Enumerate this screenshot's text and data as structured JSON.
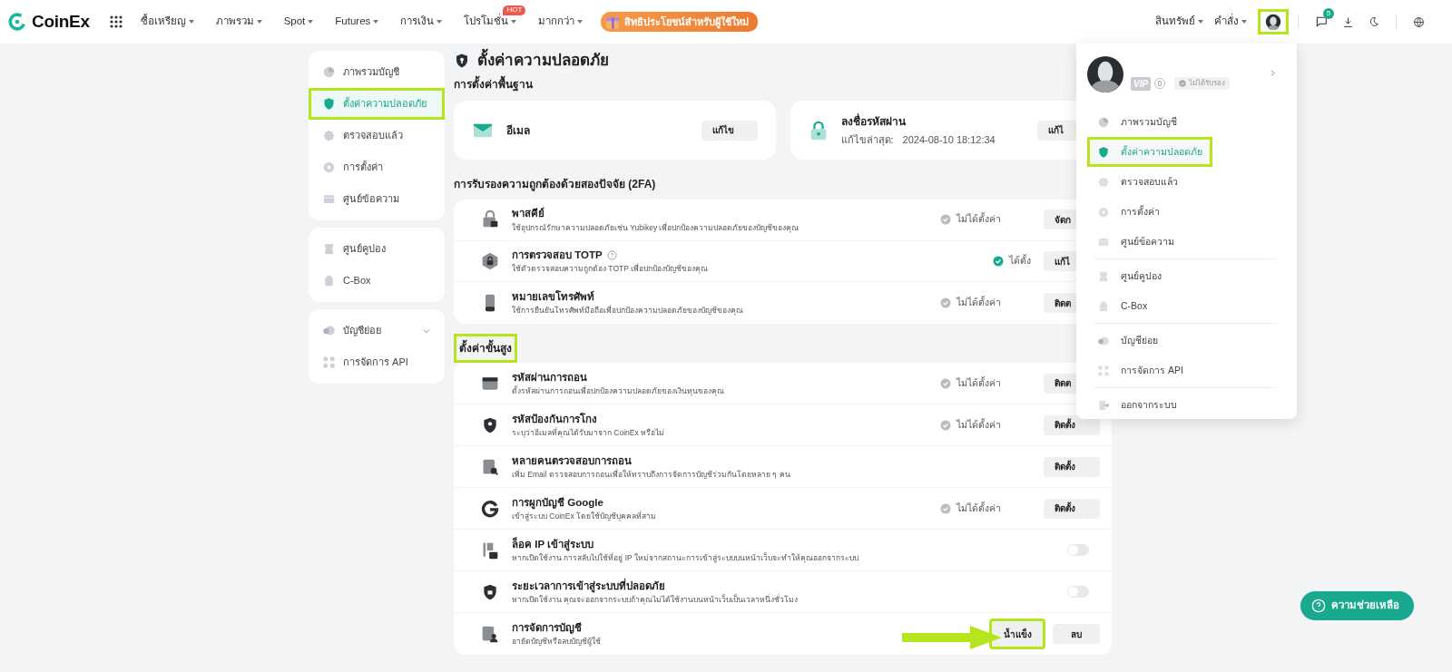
{
  "header": {
    "logo": "CoinEx",
    "nav": [
      {
        "label": "ซื้อเหรียญ",
        "dropdown": true
      },
      {
        "label": "ภาพรวม",
        "dropdown": true
      },
      {
        "label": "Spot",
        "dropdown": true
      },
      {
        "label": "Futures",
        "dropdown": true
      },
      {
        "label": "การเงิน",
        "dropdown": true
      },
      {
        "label": "โปรโมชั่น",
        "dropdown": true,
        "badge": "HOT"
      },
      {
        "label": "มากกว่า",
        "dropdown": true
      }
    ],
    "promo": "สิทธิประโยชน์สำหรับผู้ใช้ใหม่",
    "right_nav": [
      {
        "label": "สินทรัพย์",
        "dropdown": true
      },
      {
        "label": "คำสั่ง",
        "dropdown": true
      }
    ],
    "avatar_highlighted": true,
    "message_count": "5"
  },
  "sidebar": {
    "groups": [
      [
        {
          "label": "ภาพรวมบัญชี",
          "selected": false,
          "highlighted": false,
          "submenu": false
        },
        {
          "label": "ตั้งค่าความปลอดภัย",
          "selected": true,
          "highlighted": true,
          "submenu": false
        },
        {
          "label": "ตรวจสอบแล้ว",
          "selected": false,
          "highlighted": false,
          "submenu": false
        },
        {
          "label": "การตั้งค่า",
          "selected": false,
          "highlighted": false,
          "submenu": false
        },
        {
          "label": "ศูนย์ข้อความ",
          "selected": false,
          "highlighted": false,
          "submenu": false
        }
      ],
      [
        {
          "label": "ศูนย์คูปอง",
          "selected": false,
          "highlighted": false,
          "submenu": false
        },
        {
          "label": "C-Box",
          "selected": false,
          "highlighted": false,
          "submenu": false
        }
      ],
      [
        {
          "label": "บัญชีย่อย",
          "selected": false,
          "highlighted": false,
          "submenu": true
        },
        {
          "label": "การจัดการ API",
          "selected": false,
          "highlighted": false,
          "submenu": false
        }
      ]
    ]
  },
  "page": {
    "title": "ตั้งค่าความปลอดภัย",
    "basic": {
      "heading": "การตั้งค่าพื้นฐาน",
      "cards": [
        {
          "title": "อีเมล",
          "button": "แก้ไข"
        },
        {
          "title": "ลงชื่อรหัสผ่าน",
          "detail_label": "แก้ไขล่าสุด:",
          "detail_value": "2024-08-10 18:12:34",
          "button": "แก้ไ"
        }
      ]
    },
    "twofa": {
      "heading": "การรับรองความถูกต้องด้วยสองปัจจัย (2FA)",
      "highlighted": false,
      "rows": [
        {
          "kind": "button",
          "title": "พาสคีย์",
          "description": "ใช้อุปกรณ์รักษาความปลอดภัยเช่น Yubikey เพื่อปกป้องความปลอดภัยของบัญชีของคุณ",
          "status": {
            "text": "ไม่ได้ตั้งค่า",
            "set": false
          },
          "buttons": [
            {
              "label": "จัดก",
              "highlighted": false
            }
          ]
        },
        {
          "kind": "button",
          "title": "การตรวจสอบ TOTP",
          "help": true,
          "description": "ใช้ตัวตรวจสอบความถูกต้อง TOTP เพื่อปกป้องบัญชีของคุณ",
          "status": {
            "text": "ได้ตั้ง",
            "set": true
          },
          "buttons": [
            {
              "label": "แก้ไ",
              "highlighted": false
            }
          ]
        },
        {
          "kind": "button",
          "title": "หมายเลขโทรศัพท์",
          "description": "ใช้การยืนยันโทรศัพท์มือถือเพื่อปกป้องความปลอดภัยของบัญชีของคุณ",
          "status": {
            "text": "ไม่ได้ตั้งค่า",
            "set": false
          },
          "buttons": [
            {
              "label": "ติดต",
              "highlighted": false
            }
          ]
        }
      ]
    },
    "advanced": {
      "heading": "ตั้งค่าขั้นสูง",
      "highlighted": true,
      "rows": [
        {
          "kind": "button",
          "title": "รหัสผ่านการถอน",
          "description": "ตั้งรหัสผ่านการถอนเพื่อปกป้องความปลอดภัยของเงินทุนของคุณ",
          "status": {
            "text": "ไม่ได้ตั้งค่า",
            "set": false
          },
          "buttons": [
            {
              "label": "ติดต",
              "highlighted": false
            }
          ]
        },
        {
          "kind": "button",
          "title": "รหัสป้องกันการโกง",
          "description": "ระบุว่าอีเมลที่คุณได้รับมาจาก CoinEx หรือไม่",
          "status": {
            "text": "ไม่ได้ตั้งค่า",
            "set": false
          },
          "buttons": [
            {
              "label": "ติดตั้ง",
              "highlighted": false
            }
          ]
        },
        {
          "kind": "button",
          "title": "หลายคนตรวจสอบการถอน",
          "description": "เพิ่ม Email ตรวจสอบการถอนเพื่อให้ทราบถึงการจัดการบัญชีร่วมกันโดยหลาย ๆ คน",
          "buttons": [
            {
              "label": "ติดตั้ง",
              "highlighted": false
            }
          ]
        },
        {
          "kind": "button",
          "title": "การผูกบัญชี Google",
          "description": "เข้าสู่ระบบ CoinEx โดยใช้บัญชีบุคคลที่สาม",
          "status": {
            "text": "ไม่ได้ตั้งค่า",
            "set": false
          },
          "buttons": [
            {
              "label": "ติดตั้ง",
              "highlighted": false
            }
          ]
        },
        {
          "kind": "toggle",
          "title": "ล็อค IP เข้าสู่ระบบ",
          "description": "หากเปิดใช้งาน การสลับไปใช้ที่อยู่ IP ใหม่จากสถานะการเข้าสู่ระบบบนหน้าเว็บจะทำให้คุณออกจากระบบ",
          "on": false
        },
        {
          "kind": "toggle",
          "title": "ระยะเวลาการเข้าสู่ระบบที่ปลอดภัย",
          "description": "หากเปิดใช้งาน คุณจะออกจากระบบถ้าคุณไม่ได้ใช้งานบนหน้าเว็บเป็นเวลาหนึ่งชั่วโมง",
          "on": false
        },
        {
          "kind": "button",
          "title": "การจัดการบัญชี",
          "description": "อายัดบัญชีหรือลบบัญชีผู้ใช้",
          "buttons": [
            {
              "label": "น้ำแข็ง",
              "highlighted": true
            },
            {
              "label": "ลบ",
              "highlighted": false
            }
          ]
        }
      ]
    }
  },
  "menu": {
    "vip": "VIP",
    "vip_level": "0",
    "verification": "ไม่ได้รับรอง",
    "groups": [
      [
        {
          "label": "ภาพรวมบัญชี",
          "selected": false,
          "highlighted": false
        },
        {
          "label": "ตั้งค่าความปลอดภัย",
          "selected": true,
          "highlighted": true
        },
        {
          "label": "ตรวจสอบแล้ว",
          "selected": false,
          "highlighted": false
        },
        {
          "label": "การตั้งค่า",
          "selected": false,
          "highlighted": false
        },
        {
          "label": "ศูนย์ข้อความ",
          "selected": false,
          "highlighted": false
        }
      ],
      [
        {
          "label": "ศูนย์คูปอง",
          "selected": false,
          "highlighted": false
        },
        {
          "label": "C-Box",
          "selected": false,
          "highlighted": false
        }
      ],
      [
        {
          "label": "บัญชีย่อย",
          "selected": false,
          "highlighted": false
        },
        {
          "label": "การจัดการ API",
          "selected": false,
          "highlighted": false
        }
      ],
      [
        {
          "label": "ออกจากระบบ",
          "selected": false,
          "highlighted": false
        }
      ]
    ]
  },
  "help_button": "ความช่วยเหลือ"
}
